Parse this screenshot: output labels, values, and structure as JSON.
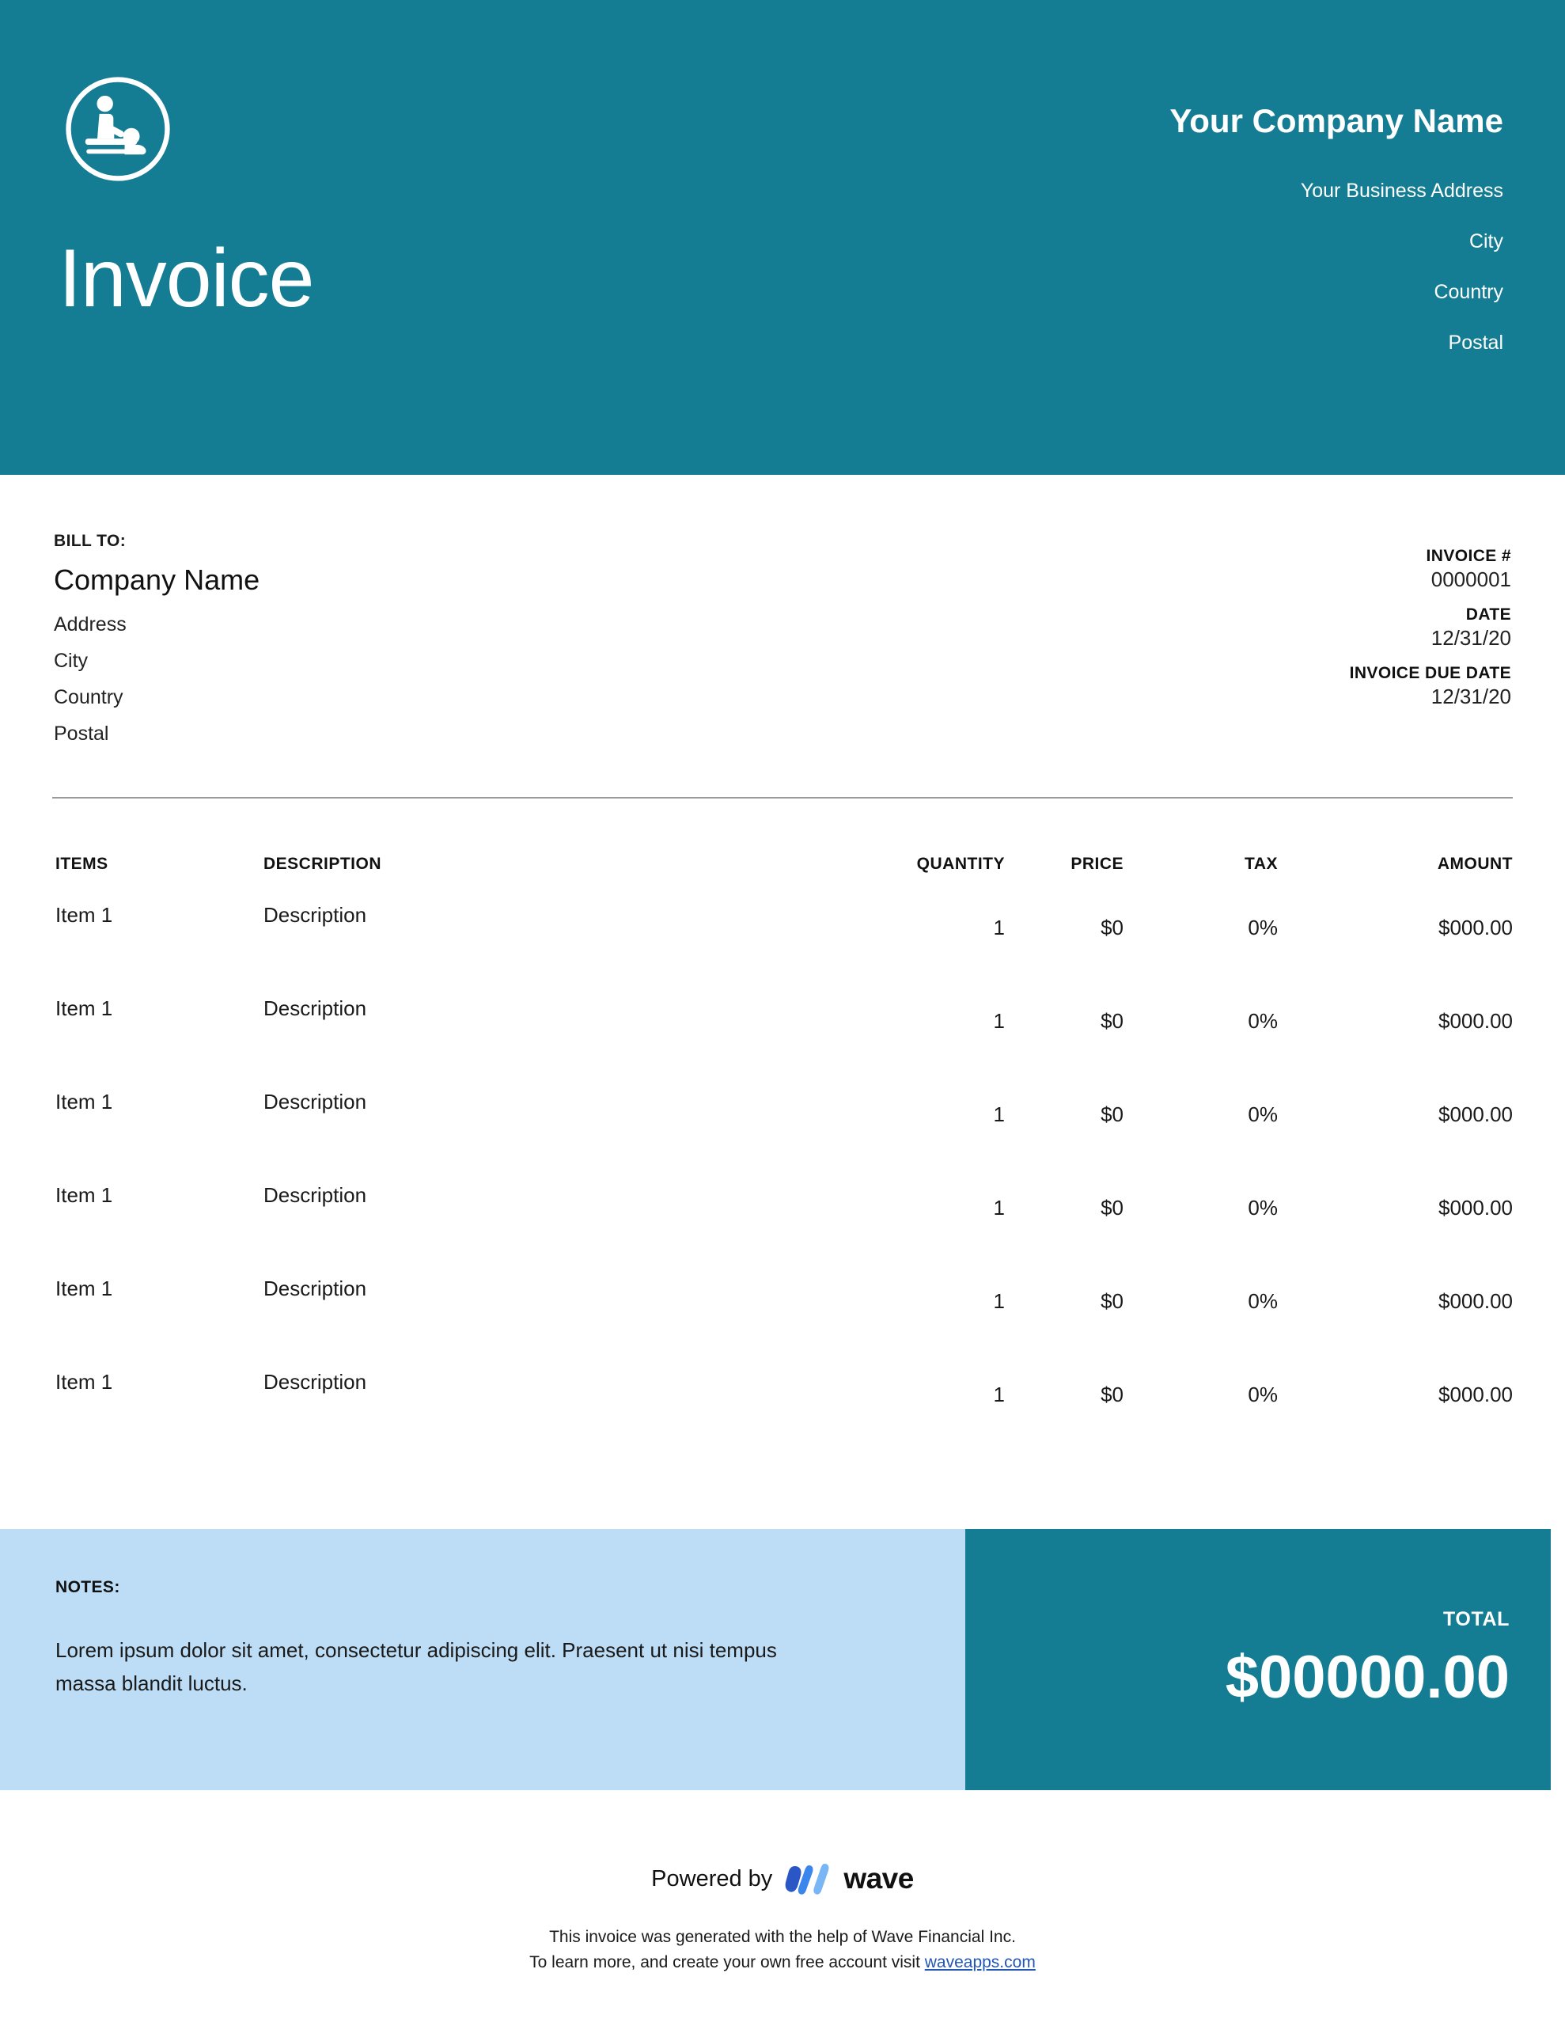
{
  "theme": {
    "teal": "#147D93",
    "light_blue": "#BCDDF5",
    "link_blue": "#2257B5",
    "wave_dark_blue": "#2B56C6",
    "wave_mid_blue": "#3B86EC",
    "wave_light_blue": "#78B6F6"
  },
  "header": {
    "logo_icon": "massage-therapy-icon",
    "title": "Invoice",
    "company_name": "Your Company Name",
    "address_lines": [
      "Your Business Address",
      "City",
      "Country",
      "Postal"
    ]
  },
  "bill_to": {
    "label": "BILL TO:",
    "company": "Company Name",
    "lines": [
      "Address",
      "City",
      "Country",
      "Postal"
    ]
  },
  "meta": {
    "invoice_number_label": "INVOICE #",
    "invoice_number": "0000001",
    "date_label": "DATE",
    "date": "12/31/20",
    "due_date_label": "INVOICE DUE DATE",
    "due_date": "12/31/20"
  },
  "table": {
    "columns": [
      "ITEMS",
      "DESCRIPTION",
      "QUANTITY",
      "PRICE",
      "TAX",
      "AMOUNT"
    ],
    "rows": [
      {
        "item": "Item 1",
        "description": "Description",
        "quantity": "1",
        "price": "$0",
        "tax": "0%",
        "amount": "$000.00"
      },
      {
        "item": "Item 1",
        "description": "Description",
        "quantity": "1",
        "price": "$0",
        "tax": "0%",
        "amount": "$000.00"
      },
      {
        "item": "Item 1",
        "description": "Description",
        "quantity": "1",
        "price": "$0",
        "tax": "0%",
        "amount": "$000.00"
      },
      {
        "item": "Item 1",
        "description": "Description",
        "quantity": "1",
        "price": "$0",
        "tax": "0%",
        "amount": "$000.00"
      },
      {
        "item": "Item 1",
        "description": "Description",
        "quantity": "1",
        "price": "$0",
        "tax": "0%",
        "amount": "$000.00"
      },
      {
        "item": "Item 1",
        "description": "Description",
        "quantity": "1",
        "price": "$0",
        "tax": "0%",
        "amount": "$000.00"
      }
    ]
  },
  "notes": {
    "label": "NOTES:",
    "body": "Lorem ipsum dolor sit amet, consectetur adipiscing elit. Praesent ut nisi tempus massa blandit luctus."
  },
  "total": {
    "label": "TOTAL",
    "amount": "$00000.00"
  },
  "footer": {
    "powered_by": "Powered by",
    "brand": "wave",
    "brand_icon": "wave-logo-icon",
    "legal_line_1": "This invoice was generated with the help of Wave Financial Inc.",
    "legal_line_2_prefix": "To learn more, and create your own free account visit ",
    "legal_link": "waveapps.com"
  }
}
